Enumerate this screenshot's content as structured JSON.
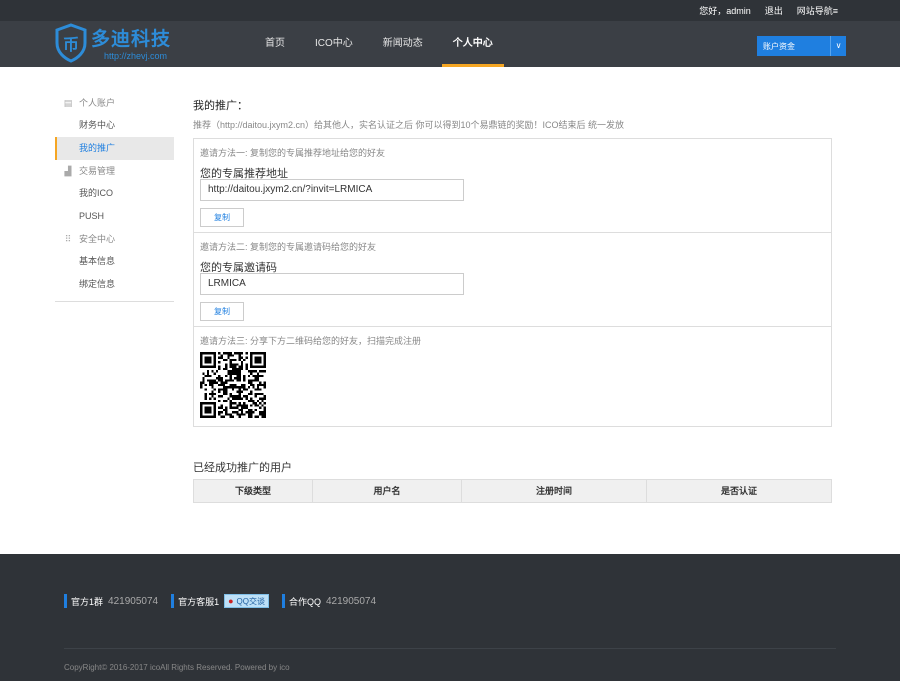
{
  "topbar": {
    "greeting": "您好，admin",
    "logout": "退出",
    "site_nav": "网站导航≡"
  },
  "logo": {
    "brand": "多迪科技",
    "domain": "http://zhevj.com"
  },
  "nav": {
    "items": [
      {
        "label": "首页"
      },
      {
        "label": "ICO中心"
      },
      {
        "label": "新闻动态"
      },
      {
        "label": "个人中心"
      }
    ]
  },
  "asset_select": {
    "value": "账户资金",
    "arrow": "∨"
  },
  "sidebar": {
    "groups": [
      {
        "label": "个人账户",
        "icon": "▤",
        "items": [
          "财务中心",
          "我的推广"
        ]
      },
      {
        "label": "交易管理",
        "icon": "▟",
        "items": [
          "我的ICO",
          "PUSH"
        ]
      },
      {
        "label": "安全中心",
        "icon": "⠿",
        "items": [
          "基本信息",
          "绑定信息"
        ]
      }
    ]
  },
  "main": {
    "title": "我的推广：",
    "note": "推荐（http://daitou.jxym2.cn）给其他人，实名认证之后 你可以得到10个易鼎链的奖励！ICO结束后 统一发放",
    "method1": {
      "label": "邀请方法一: 复制您的专属推荐地址给您的好友",
      "field_label": "您的专属推荐地址",
      "value": "http://daitou.jxym2.cn/?invit=LRMICA",
      "copy": "复制"
    },
    "method2": {
      "label": "邀请方法二: 复制您的专属邀请码给您的好友",
      "field_label": "您的专属邀请码",
      "value": "LRMICA",
      "copy": "复制"
    },
    "method3": {
      "label": "邀请方法三: 分享下方二维码给您的好友，扫描完成注册"
    },
    "promoted_title": "已经成功推广的用户",
    "table_headers": [
      "下级类型",
      "用户名",
      "注册时间",
      "是否认证"
    ]
  },
  "footer": {
    "contacts": [
      {
        "label": "官方1群",
        "value": "421905074"
      },
      {
        "label": "官方客服1",
        "badge": "QQ交谈"
      },
      {
        "label": "合作QQ",
        "value": "421905074"
      }
    ],
    "copyright": "CopyRight© 2016-2017 icoAll Rights Reserved. Powered by ico"
  },
  "colors": {
    "accent": "#1f7fe0",
    "active_underline": "#f5a623",
    "header_bg": "#3b3f45",
    "footer_bg": "#2f3338"
  }
}
